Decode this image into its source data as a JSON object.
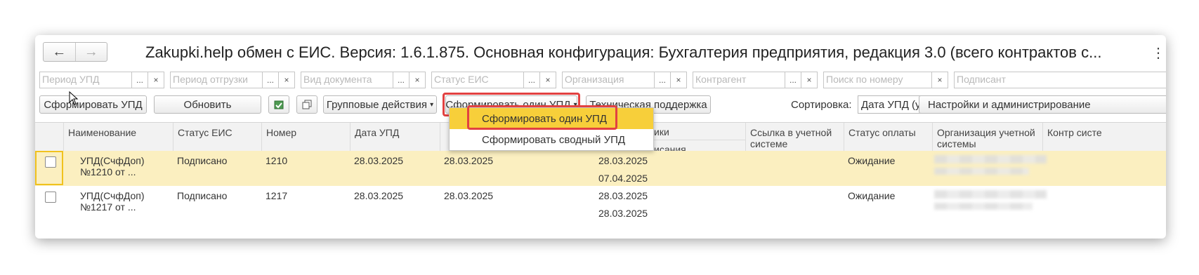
{
  "title": "Zakupki.help обмен с ЕИС. Версия: 1.6.1.875. Основная конфигурация: Бухгалтерия предприятия, редакция 3.0 (всего контрактов с...",
  "nav": {
    "back_glyph": "←",
    "forward_glyph": "→",
    "menu_glyph": "⋮"
  },
  "filters": [
    {
      "placeholder": "Период УПД",
      "dots": "...",
      "clear": "×"
    },
    {
      "placeholder": "Период отгрузки",
      "dots": "...",
      "clear": "×"
    },
    {
      "placeholder": "Вид документа",
      "dots": "...",
      "clear": "×"
    },
    {
      "placeholder": "Статус ЕИС",
      "dots": "...",
      "clear": "×"
    },
    {
      "placeholder": "Организация",
      "dots": "...",
      "clear": "×"
    },
    {
      "placeholder": "Контрагент",
      "dots": "...",
      "clear": "×"
    },
    {
      "placeholder": "Поиск по номеру",
      "clear": "×"
    },
    {
      "placeholder": "Подписант"
    }
  ],
  "toolbar": {
    "form_upd": "Сформировать УПД",
    "refresh": "Обновить",
    "group_actions": "Групповые действия",
    "form_one_upd": "Сформировать один УПД",
    "support": "Техническая поддержка",
    "sort_label": "Сортировка:",
    "sort_value": "Дата УПД (убыв)",
    "settings": "Настройки и администрирование",
    "dropdown_glyph": "▾"
  },
  "dropdown": {
    "items": [
      "Сформировать один УПД",
      "Сформировать сводный УПД"
    ]
  },
  "columns": {
    "name": "Наименование",
    "status": "Статус ЕИС",
    "number": "Номер",
    "date": "Дата УПД",
    "partial1": "ики",
    "partial2": "исания контрагентом",
    "link": "Ссылка в учетной системе",
    "pay": "Статус оплаты",
    "org": "Организация учетной системы",
    "contr": "Контр систе"
  },
  "rows": [
    {
      "name": "УПД(СчфДоп) №1210 от ...",
      "status": "Подписано",
      "number": "1210",
      "date": "28.03.2025",
      "date2": "28.03.2025",
      "d3": "28.03.2025",
      "d4": "07.04.2025",
      "pay": "Ожидание"
    },
    {
      "name": "УПД(СчфДоп) №1217 от ...",
      "status": "Подписано",
      "number": "1217",
      "date": "28.03.2025",
      "date2": "28.03.2025",
      "d3": "28.03.2025",
      "d4": "28.03.2025",
      "pay": "Ожидание"
    }
  ],
  "colors": {
    "selected_row": "#fbefc0",
    "menu_active": "#f7cf3a",
    "highlight": "#e24141"
  }
}
